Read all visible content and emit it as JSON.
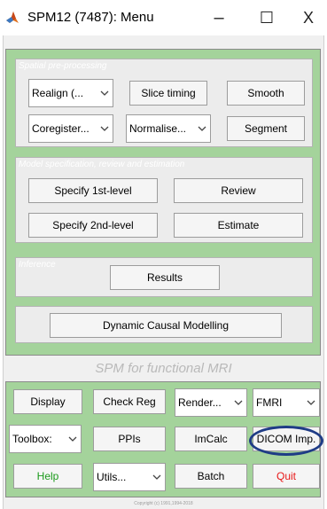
{
  "window": {
    "title": "SPM12 (7487): Menu",
    "minimize_glyph": "–",
    "maximize_glyph": "☐",
    "close_glyph": "X",
    "icon": "matlab-logo-icon"
  },
  "colors": {
    "panel_green": "#a4d39b",
    "help_text": "#1c9a1c",
    "quit_text": "#e81818",
    "highlight_ring": "#1f3c86"
  },
  "preprocessing": {
    "label": "Spatial pre-processing",
    "realign": "Realign (...",
    "slice_timing": "Slice timing",
    "smooth": "Smooth",
    "coregister": "Coregister...",
    "normalise": "Normalise...",
    "segment": "Segment"
  },
  "model": {
    "label": "Model specification, review and estimation",
    "specify_1st": "Specify 1st-level",
    "review": "Review",
    "specify_2nd": "Specify 2nd-level",
    "estimate": "Estimate"
  },
  "inference": {
    "label": "Inference",
    "results": "Results"
  },
  "dcm": {
    "label": "Dynamic Causal Modelling"
  },
  "footer_title": "SPM for functional MRI",
  "utilities": {
    "display": "Display",
    "check_reg": "Check Reg",
    "render": "Render...",
    "modality": "FMRI",
    "toolbox": "Toolbox:",
    "ppis": "PPIs",
    "imcalc": "ImCalc",
    "dicom_import": "DICOM Imp.",
    "help": "Help",
    "utils": "Utils...",
    "batch": "Batch",
    "quit": "Quit"
  },
  "copyright": "Copyright (c) 1991,1994-2018"
}
